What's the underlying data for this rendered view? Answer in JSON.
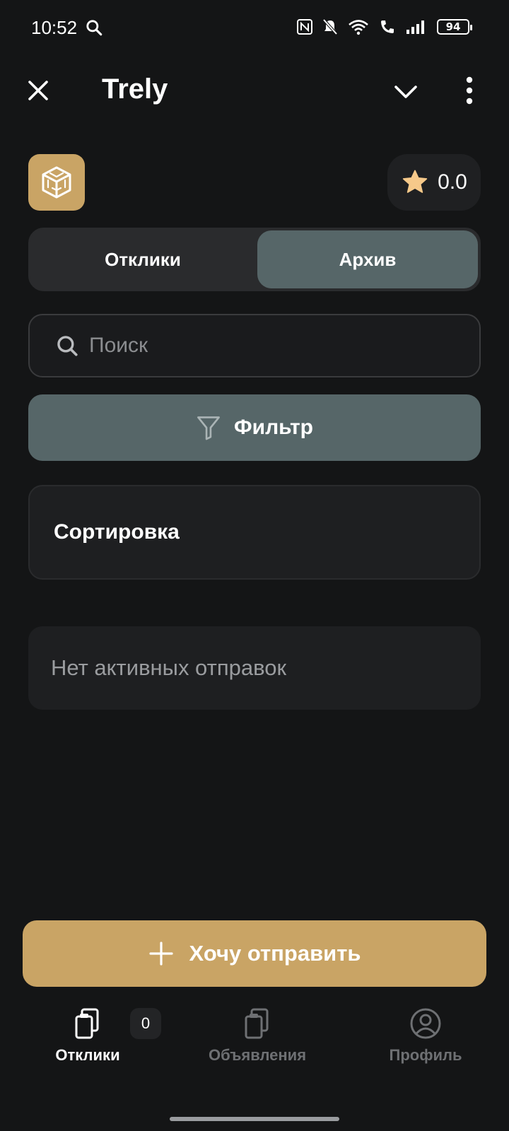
{
  "status_bar": {
    "time": "10:52",
    "battery": "94",
    "icons": [
      "search-icon",
      "nfc-icon",
      "mute-icon",
      "wifi-icon",
      "wifi-call-icon",
      "signal-icon",
      "battery-icon"
    ]
  },
  "header": {
    "title": "Trely",
    "icons": [
      "close-icon",
      "chevron-down-icon",
      "more-vertical-icon"
    ]
  },
  "rating": {
    "value": "0.0",
    "star_color": "#f6c98a"
  },
  "tabs": [
    {
      "label": "Отклики",
      "active": false
    },
    {
      "label": "Архив",
      "active": true
    }
  ],
  "search": {
    "placeholder": "Поиск",
    "value": ""
  },
  "filter": {
    "label": "Фильтр"
  },
  "sort": {
    "label": "Сортировка"
  },
  "empty_state": {
    "text": "Нет активных отправок"
  },
  "cta": {
    "label": "Хочу отправить"
  },
  "bottom_nav": {
    "items": [
      {
        "label": "Отклики",
        "icon": "clipboards-icon",
        "active": true,
        "badge": "0"
      },
      {
        "label": "Объявления",
        "icon": "clipboards-icon",
        "active": false
      },
      {
        "label": "Профиль",
        "icon": "user-circle-icon",
        "active": false
      }
    ]
  },
  "colors": {
    "background": "#141516",
    "accent": "#c9a465",
    "active_tab": "#566668"
  }
}
